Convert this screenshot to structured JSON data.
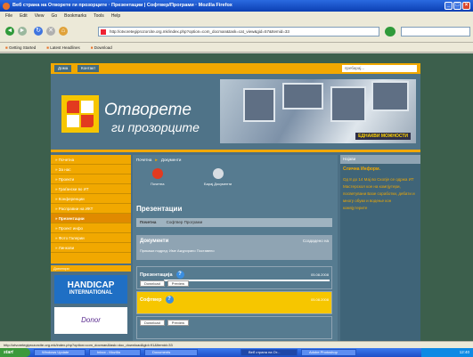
{
  "browser": {
    "title": "Веб страна на Отворете ги прозорците · Презентации | Софтвер/Програми · Mozilla Firefox",
    "menu": [
      "File",
      "Edit",
      "View",
      "Go",
      "Bookmarks",
      "Tools",
      "Help"
    ],
    "url": "http://otvoretegiprozorcite.org.mk/index.php?option=com_docman&task=cat_view&gid=57&Itemid=33",
    "bookmarks": [
      "Getting Started",
      "Latest Headlines",
      "Download"
    ],
    "status": "http://otvoretegiprozorcite.org.mk/index.php?option=com_docman&task=doc_download&gid=91&Itemid=33",
    "icons": {
      "back": "back-arrow-icon",
      "forward": "forward-arrow-icon",
      "reload": "reload-icon",
      "stop": "stop-icon",
      "home": "home-icon",
      "go": "go-arrow-icon"
    }
  },
  "site": {
    "top_buttons": [
      "Дома",
      "Контакт"
    ],
    "search_placeholder": "пребарај...",
    "slogan_line1": "Отворете",
    "slogan_line2": "ги прозорците",
    "banner_tag": "ЕДНАКВИ МОЖНОСТИ"
  },
  "sidebar": {
    "menu": [
      {
        "label": "Почетна",
        "active": false
      },
      {
        "label": "За нас",
        "active": false
      },
      {
        "label": "Проекти",
        "active": false
      },
      {
        "label": "Граѓански во ИТ",
        "active": false
      },
      {
        "label": "Конференции",
        "active": false
      },
      {
        "label": "Расправии на ИКТ",
        "active": false
      },
      {
        "label": "Презентации",
        "active": true
      },
      {
        "label": "Проект инфо",
        "active": false
      },
      {
        "label": "Фото Галерии",
        "active": false
      },
      {
        "label": "Линкови",
        "active": false
      }
    ],
    "partners_label": "Донатори",
    "handicap": {
      "line1": "HANDICAP",
      "line2": "INTERNATIONAL"
    },
    "sponsor": "Donor"
  },
  "content": {
    "breadcrumb": [
      "Почетна",
      "Документи"
    ],
    "icon_links": [
      {
        "label": "Почетна",
        "icon": "home-arrow-icon"
      },
      {
        "label": "Барај Документи",
        "icon": "search-magnifier-icon"
      }
    ],
    "heading": "Презентации",
    "tabs": [
      "Почетна",
      "Софтвер Програми"
    ],
    "docs_panel": {
      "title": "Документи",
      "right": "Создадено на",
      "subtitle": "Прикажи подред: Име  Ажурирано  Поставено"
    },
    "items": [
      {
        "name": "Презентација",
        "date": "05.08.2008",
        "buttons": [
          "Download",
          "Preview"
        ]
      },
      {
        "name": "Софтвер",
        "date": "05.08.2008",
        "buttons": [
          "Download",
          "Preview"
        ]
      },
      {
        "name": "",
        "date": "",
        "buttons": [
          "Download",
          "Preview"
        ]
      }
    ]
  },
  "rightcol": {
    "header": "Најави",
    "title": "Слична Информ.",
    "text": "Од 8 до 14 Мај во Скопје се одржа ИТ Мастерскол кое на компјутери, посветувани Базе соработки, дебати и многу обуки и водење кон компјутерите"
  },
  "taskbar": {
    "start": "start",
    "tasks": [
      "Windows Update",
      "Inbox - Mozilla",
      "Documents",
      "Веб страна на От...",
      "Adobe Photoshop"
    ],
    "active_index": 3,
    "clock": "12:40"
  }
}
